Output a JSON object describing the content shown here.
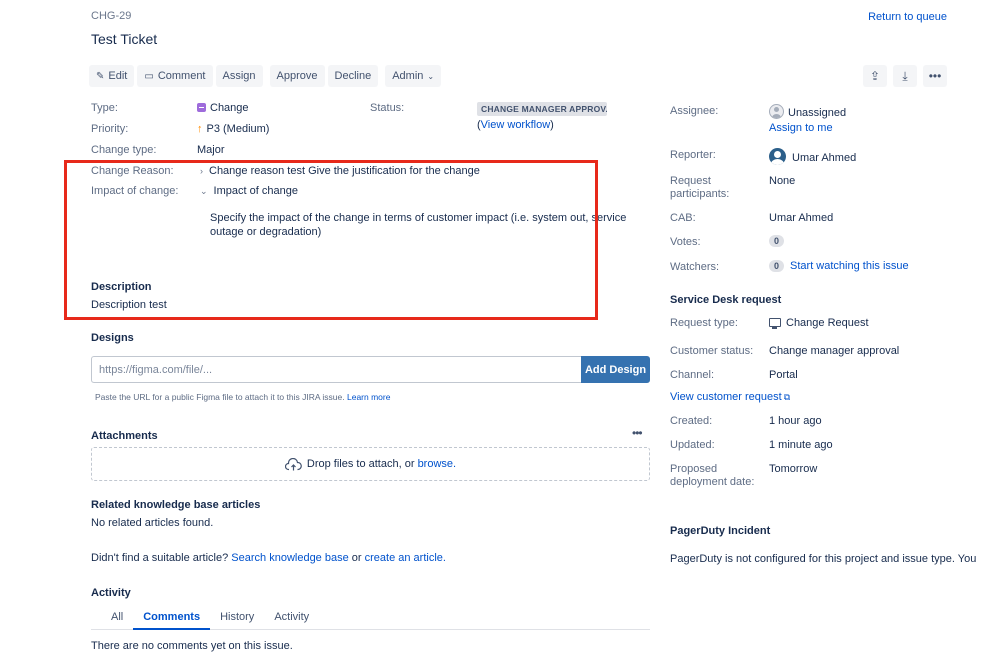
{
  "header": {
    "issue_key": "CHG-29",
    "title": "Test Ticket",
    "return_link": "Return to queue"
  },
  "toolbar": {
    "edit": "Edit",
    "comment": "Comment",
    "assign": "Assign",
    "approve": "Approve",
    "decline": "Decline",
    "admin": "Admin"
  },
  "details": {
    "type_label": "Type:",
    "type_value": "Change",
    "priority_label": "Priority:",
    "priority_value": "P3 (Medium)",
    "change_type_label": "Change type:",
    "change_type_value": "Major",
    "status_label": "Status:",
    "status_value": "CHANGE MANAGER APPROV...",
    "view_workflow_open": "(",
    "view_workflow": "View workflow",
    "view_workflow_close": ")",
    "change_reason_label": "Change Reason:",
    "change_reason_value": "Change reason test Give the justification for the change",
    "impact_label": "Impact of change:",
    "impact_value": "Impact of change",
    "impact_text_1": "Specify the impact of the change in terms of customer impact (i.e. system out, service",
    "impact_text_2": "outage or degradation)"
  },
  "description": {
    "title": "Description",
    "text": "Description test"
  },
  "designs": {
    "title": "Designs",
    "placeholder": "https://figma.com/file/...",
    "add_button": "Add Design",
    "helper": "Paste the URL for a public Figma file to attach it to this JIRA issue.",
    "learn_more": "Learn more"
  },
  "attachments": {
    "title": "Attachments",
    "drop_text": "Drop files to attach, or",
    "browse": "browse."
  },
  "kb": {
    "title": "Related knowledge base articles",
    "none": "No related articles found.",
    "not_found": "Didn't find a suitable article?",
    "search_link": "Search knowledge base",
    "or": "or",
    "create_link": "create an article."
  },
  "activity": {
    "title": "Activity",
    "tabs": [
      "All",
      "Comments",
      "History",
      "Activity"
    ],
    "active_tab": "Comments",
    "empty": "There are no comments yet on this issue."
  },
  "people": {
    "assignee_label": "Assignee:",
    "assignee_value": "Unassigned",
    "assign_to_me": "Assign to me",
    "reporter_label": "Reporter:",
    "reporter_value": "Umar Ahmed",
    "participants_label_1": "Request",
    "participants_label_2": "participants:",
    "participants_value": "None",
    "cab_label": "CAB:",
    "cab_value": "Umar Ahmed",
    "votes_label": "Votes:",
    "votes_value": "0",
    "watchers_label": "Watchers:",
    "watchers_value": "0",
    "start_watching": "Start watching this issue"
  },
  "service_desk": {
    "title": "Service Desk request",
    "request_type_label": "Request type:",
    "request_type_value": "Change Request",
    "customer_status_label": "Customer status:",
    "customer_status_value": "Change manager approval",
    "channel_label": "Channel:",
    "channel_value": "Portal",
    "view_request": "View customer request",
    "created_label": "Created:",
    "created_value": "1 hour ago",
    "updated_label": "Updated:",
    "updated_value": "1 minute ago",
    "proposed_label_1": "Proposed",
    "proposed_label_2": "deployment date:",
    "proposed_value": "Tomorrow"
  },
  "pagerduty": {
    "title": "PagerDuty Incident",
    "text": "PagerDuty is not configured for this project and issue type. You"
  },
  "colors": {
    "highlight": "#e7291a",
    "link": "#0052cc",
    "button_primary": "#3572b0"
  }
}
